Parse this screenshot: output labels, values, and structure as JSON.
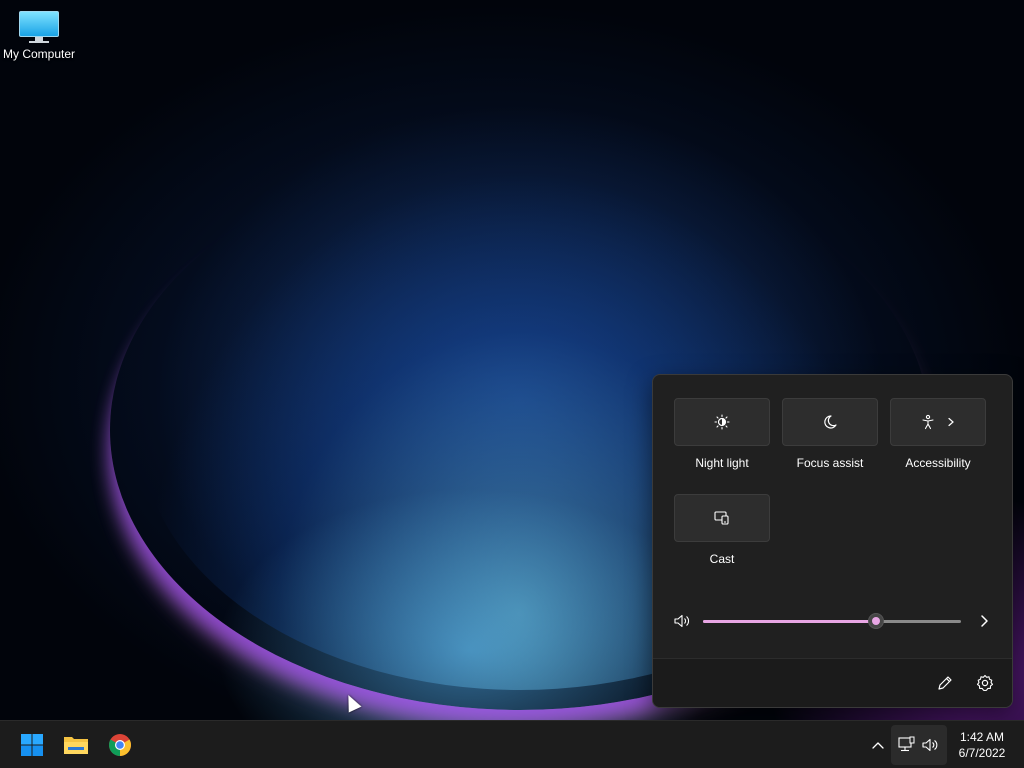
{
  "desktop": {
    "icons": [
      {
        "label": "My Computer",
        "icon": "monitor-icon"
      }
    ]
  },
  "quick_settings": {
    "tiles": [
      {
        "label": "Night light",
        "icon": "night-light-icon",
        "has_submenu": false
      },
      {
        "label": "Focus assist",
        "icon": "moon-icon",
        "has_submenu": false
      },
      {
        "label": "Accessibility",
        "icon": "accessibility-icon",
        "has_submenu": true
      },
      {
        "label": "Cast",
        "icon": "cast-icon",
        "has_submenu": false
      }
    ],
    "volume": {
      "level_percent": 67,
      "icon": "speaker-icon",
      "more_icon": "chevron-right-icon"
    },
    "footer": {
      "edit_icon": "pencil-icon",
      "settings_icon": "gear-icon"
    },
    "accent_color": "#e8a6e4"
  },
  "taskbar": {
    "apps": [
      {
        "name": "Start",
        "icon": "windows-logo-icon"
      },
      {
        "name": "File Explorer",
        "icon": "folder-icon"
      },
      {
        "name": "Google Chrome",
        "icon": "chrome-icon"
      }
    ],
    "tray": {
      "overflow_icon": "chevron-up-icon",
      "network_icon": "network-icon",
      "volume_icon": "speaker-icon"
    },
    "clock": {
      "time": "1:42 AM",
      "date": "6/7/2022"
    }
  }
}
